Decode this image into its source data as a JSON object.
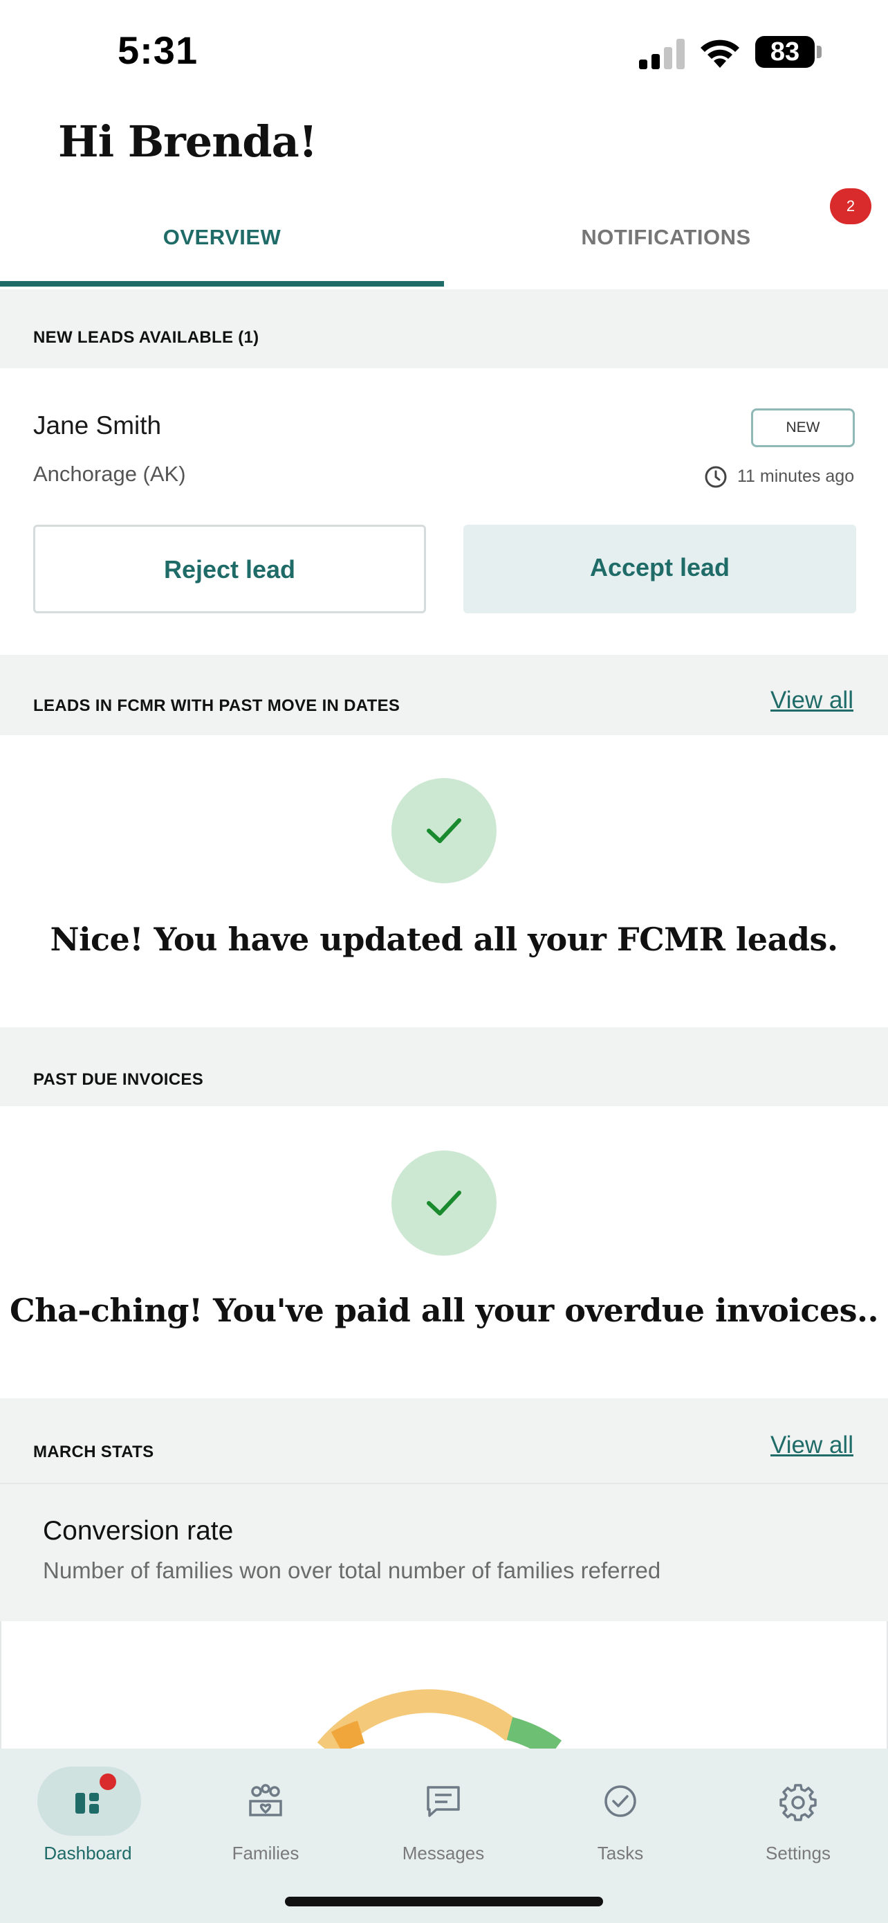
{
  "status_bar": {
    "time": "5:31",
    "battery": "83"
  },
  "header": {
    "greeting": "Hi Brenda!"
  },
  "tabs": [
    {
      "label": "OVERVIEW",
      "active": true
    },
    {
      "label": "NOTIFICATIONS",
      "active": false,
      "badge": "2"
    }
  ],
  "new_leads": {
    "title": "NEW LEADS AVAILABLE (1)",
    "lead": {
      "name": "Jane Smith",
      "location": "Anchorage (AK)",
      "badge": "NEW",
      "time_ago": "11 minutes ago",
      "reject_label": "Reject lead",
      "accept_label": "Accept lead"
    }
  },
  "fcmr": {
    "title": "LEADS IN FCMR WITH PAST MOVE IN DATES",
    "view_all": "View all",
    "message": "Nice! You have updated all your FCMR leads."
  },
  "invoices": {
    "title": "PAST DUE INVOICES",
    "message": "Cha-ching! You've paid all your overdue invoices.."
  },
  "stats": {
    "title": "MARCH STATS",
    "view_all": "View all",
    "card_title": "Conversion rate",
    "card_desc": "Number of families won over total number of families referred"
  },
  "nav": [
    {
      "label": "Dashboard",
      "icon": "dashboard-icon",
      "active": true
    },
    {
      "label": "Families",
      "icon": "families-icon",
      "active": false
    },
    {
      "label": "Messages",
      "icon": "messages-icon",
      "active": false
    },
    {
      "label": "Tasks",
      "icon": "tasks-icon",
      "active": false
    },
    {
      "label": "Settings",
      "icon": "settings-icon",
      "active": false
    }
  ],
  "colors": {
    "accent": "#1e6b68",
    "badge_red": "#d92b2b",
    "success_bg": "#cde8d2",
    "success_check": "#1a8a2e",
    "section_bg": "#f1f3f3"
  }
}
